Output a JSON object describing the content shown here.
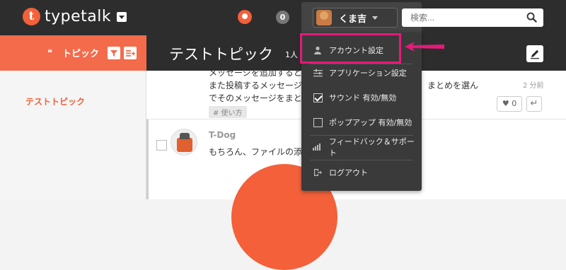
{
  "app": {
    "logo_letter": "t",
    "logo_name": "typetalk"
  },
  "header": {
    "notification_count": "0",
    "user_name": "くま吉",
    "search_placeholder": "検索..."
  },
  "topic_bar": {
    "label": "トピック",
    "title": "テストトピック",
    "members": "1人"
  },
  "sidebar": {
    "items": [
      {
        "label": "テストトピック"
      }
    ]
  },
  "post1": {
    "line1": "メッセージを追加すると",
    "line2": "また投稿するメッセージ",
    "line2_tail": "まとめを選ん",
    "line3": "でそのメッセージをまと",
    "tag": "# 使い方",
    "time": "2 分前",
    "likes": "0"
  },
  "post2": {
    "author": "T-Dog",
    "line1": "もちろん、ファイルの添"
  },
  "menu": {
    "items": [
      {
        "label": "アカウント設定",
        "icon": "person-icon"
      },
      {
        "label": "アプリケーション設定",
        "icon": "sliders-icon"
      },
      {
        "label": "サウンド 有効/無効",
        "icon": "checkbox-checked-icon"
      },
      {
        "label": "ポップアップ 有効/無効",
        "icon": "checkbox-empty-icon"
      },
      {
        "label": "フィードバック＆サポート",
        "icon": "megaphone-icon"
      },
      {
        "label": "ログアウト",
        "icon": "logout-icon"
      }
    ]
  },
  "colors": {
    "brand": "#f3603a",
    "topbar": "#2d2d2d",
    "menu_bg": "#3a3a3a",
    "highlight": "#e6197a"
  }
}
